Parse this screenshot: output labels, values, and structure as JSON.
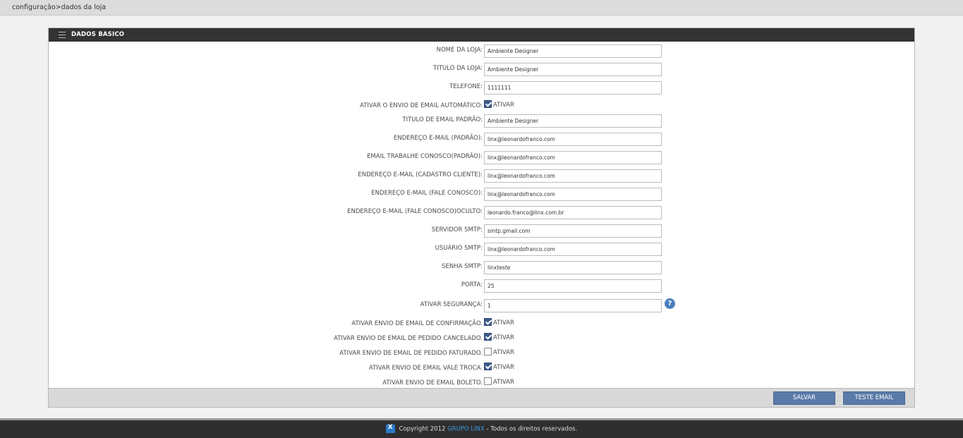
{
  "breadcrumb": "configuração>dados da loja",
  "panel": {
    "title": "DADOS BASICO"
  },
  "fields": {
    "nome_loja": {
      "label": "NOME DA LOJA:",
      "value": "Ambiente Designer"
    },
    "titulo_loja": {
      "label": "TITULO DA LOJA:",
      "value": "Ambiente Designer"
    },
    "telefone": {
      "label": "TELEFONE:",
      "value": "1111111"
    },
    "envio_auto": {
      "label": "ATIVAR O ENVIO DE EMAIL AUTOMÁTICO:",
      "option": "ATIVAR",
      "checked": true
    },
    "titulo_email": {
      "label": "TITULO DE EMAIL PADRÃO:",
      "value": "Ambiente Designer"
    },
    "email_padrao": {
      "label": "ENDEREÇO E-MAIL (PADRÃO):",
      "value": "linx@leonardofranco.com"
    },
    "email_trabalhe": {
      "label": "EMAIL TRABALHE CONOSCO(PADRÃO):",
      "value": "linx@leonardofranco.com"
    },
    "email_cadastro": {
      "label": "ENDEREÇO E-MAIL (CADASTRO CLIENTE):",
      "value": "linx@leonardofranco.com"
    },
    "email_fale": {
      "label": "ENDEREÇO E-MAIL (FALE CONOSCO):",
      "value": "linx@leonardofranco.com"
    },
    "email_oculto": {
      "label": "ENDEREÇO E-MAIL (FALE CONOSCO)OCULTO:",
      "value": "leonardo.franco@linx.com.br"
    },
    "smtp_server": {
      "label": "SERVIDOR SMTP:",
      "value": "smtp.gmail.com"
    },
    "smtp_user": {
      "label": "USUÁRIO SMTP:",
      "value": "linx@leonardofranco.com"
    },
    "smtp_pass": {
      "label": "SENHA SMTP:",
      "value": "linxteste"
    },
    "porta": {
      "label": "PORTA:",
      "value": "25"
    },
    "seguranca": {
      "label": "ATIVAR SEGURANÇA:",
      "value": "1"
    },
    "envio_confirmacao": {
      "label": "ATIVAR ENVIO DE EMAIL DE CONFIRMAÇÃO.",
      "option": "ATIVAR",
      "checked": true
    },
    "envio_cancelado": {
      "label": "ATIVAR ENVIO DE EMAIL DE PEDIDO CANCELADO.",
      "option": "ATIVAR",
      "checked": true
    },
    "envio_faturado": {
      "label": "ATIVAR ENVIO DE EMAIL DE PEDIDO FATURADO.",
      "option": "ATIVAR",
      "checked": false
    },
    "envio_vale": {
      "label": "ATIVAR ENVIO DE EMAIL VALE TROCA.",
      "option": "ATIVAR",
      "checked": true
    },
    "envio_boleto": {
      "label": "ATIVAR ENVIO DE EMAIL BOLETO.",
      "option": "ATIVAR",
      "checked": false
    }
  },
  "buttons": {
    "save": "SALVAR",
    "test": "TESTE EMAIL"
  },
  "footer": {
    "prefix": "Copyright 2012",
    "brand": "GRUPO LINX",
    "suffix": "- Todos os direitos reservados."
  },
  "icons": {
    "menu": "menu-icon",
    "help": "help-icon",
    "logo": "linx-logo-icon"
  },
  "colors": {
    "header": "#333333",
    "button": "#5a7aa8",
    "brand": "#3b9ae1"
  }
}
